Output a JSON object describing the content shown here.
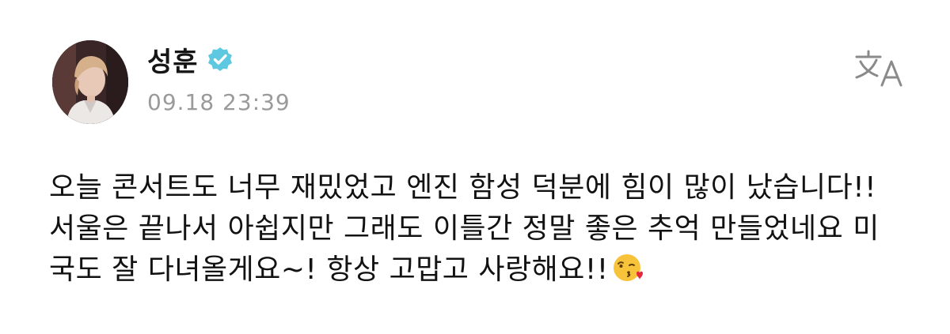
{
  "post": {
    "author_name": "성훈",
    "verified_icon": "verified-badge-icon",
    "timestamp": "09.18 23:39",
    "translate_icon": "translate-icon",
    "content_lines": [
      "오늘 콘서트도 너무 재밌었고 엔진 함성 덕분에 힘이 많이 났습니다!!",
      "서울은 끝나서 아쉽지만 그래도 이틀간 정말 좋은 추억 만들었네요 미",
      "국도 잘 다녀올게요~! 항상 고맙고 사랑해요!!"
    ],
    "emoji": "face-blowing-kiss-emoji"
  },
  "colors": {
    "verified": "#5ec8e0",
    "timestamp": "#9a9a9a",
    "text": "#121212",
    "icon": "#8a8a8a"
  }
}
